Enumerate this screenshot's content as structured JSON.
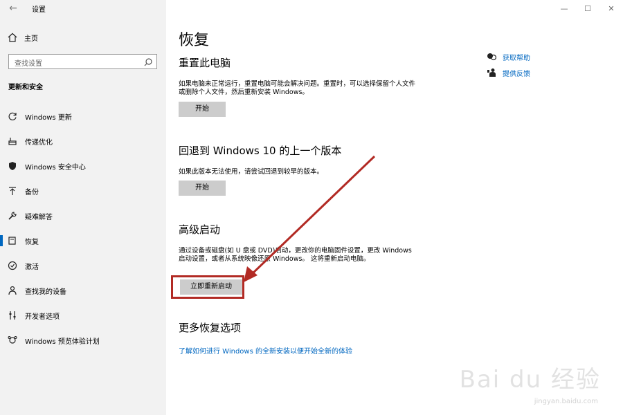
{
  "window": {
    "title": "设置",
    "back_icon": "back-arrow-icon",
    "controls": {
      "minimize": "—",
      "maximize": "☐",
      "close": "✕"
    }
  },
  "sidebar": {
    "home_label": "主页",
    "search_placeholder": "查找设置",
    "section_title": "更新和安全",
    "items": [
      {
        "label": "Windows 更新",
        "icon": "refresh-icon"
      },
      {
        "label": "传递优化",
        "icon": "delivery-optimization-icon"
      },
      {
        "label": "Windows 安全中心",
        "icon": "shield-icon"
      },
      {
        "label": "备份",
        "icon": "backup-icon"
      },
      {
        "label": "疑难解答",
        "icon": "wrench-icon"
      },
      {
        "label": "恢复",
        "icon": "recovery-icon",
        "active": true
      },
      {
        "label": "激活",
        "icon": "activation-icon"
      },
      {
        "label": "查找我的设备",
        "icon": "find-device-icon"
      },
      {
        "label": "开发者选项",
        "icon": "developer-icon"
      },
      {
        "label": "Windows 预览体验计划",
        "icon": "insider-icon"
      }
    ]
  },
  "main": {
    "title": "恢复",
    "reset": {
      "heading": "重置此电脑",
      "desc": "如果电脑未正常运行，重置电脑可能会解决问题。重置时，可以选择保留个人文件或删除个人文件，然后重新安装 Windows。",
      "button": "开始"
    },
    "rollback": {
      "heading": "回退到 Windows 10 的上一个版本",
      "desc": "如果此版本无法使用，请尝试回退到较早的版本。",
      "button": "开始"
    },
    "advanced": {
      "heading": "高级启动",
      "desc": "通过设备或磁盘(如 U 盘或 DVD)启动，更改你的电脑固件设置，更改 Windows 启动设置，或者从系统映像还原 Windows。 这将重新启动电脑。",
      "button": "立即重新启动"
    },
    "more": {
      "heading": "更多恢复选项",
      "link": "了解如何进行 Windows 的全新安装以便开始全新的体验"
    }
  },
  "help": {
    "get_help": "获取帮助",
    "feedback": "提供反馈"
  },
  "overlay": {
    "watermark": "Bai du 经验",
    "watermark_sub": "jingyan.baidu.com",
    "annotation_color": "#b22a24"
  },
  "colors": {
    "accent": "#0067c0",
    "sidebar_bg": "#f2f2f2",
    "button_bg": "#cccccc"
  }
}
